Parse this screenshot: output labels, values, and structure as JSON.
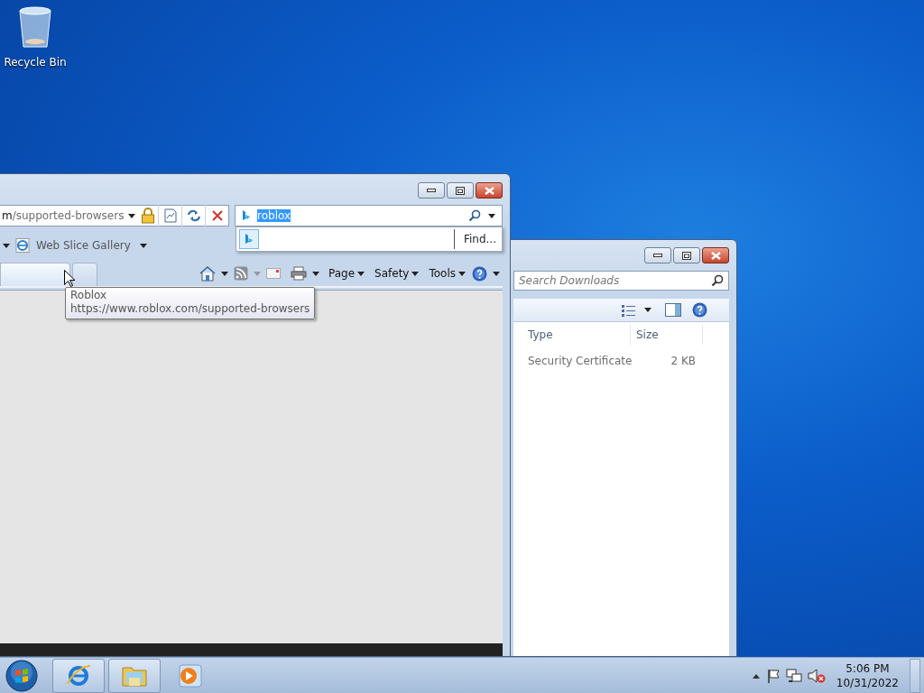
{
  "desktop": {
    "icons": [
      {
        "label": "Recycle Bin"
      }
    ]
  },
  "browser": {
    "address": {
      "domain_part": "m",
      "path_part": "/supported-browsers"
    },
    "search": {
      "value": "roblox",
      "selected": true
    },
    "search_dropdown": {
      "find_label": "Find..."
    },
    "favorites": [
      {
        "label": "Web Slice Gallery"
      }
    ],
    "tabs": [
      {
        "selected": true
      },
      {
        "selected": false
      }
    ],
    "commands": [
      {
        "label": "Page"
      },
      {
        "label": "Safety"
      },
      {
        "label": "Tools"
      }
    ],
    "tooltip": {
      "title": "Roblox",
      "url": "https://www.roblox.com/supported-browsers"
    }
  },
  "explorer": {
    "search": {
      "placeholder": "Search Downloads"
    },
    "columns": [
      "Type",
      "Size"
    ],
    "rows": [
      {
        "type": "Security Certificate",
        "size": "2 KB"
      }
    ]
  },
  "taskbar": {
    "apps": [
      {
        "kind": "browser",
        "running": true
      },
      {
        "kind": "folder",
        "running": true
      },
      {
        "kind": "media",
        "running": false
      }
    ],
    "volume_muted": true,
    "clock": {
      "time": "5:06 PM",
      "date": "10/31/2022"
    }
  }
}
